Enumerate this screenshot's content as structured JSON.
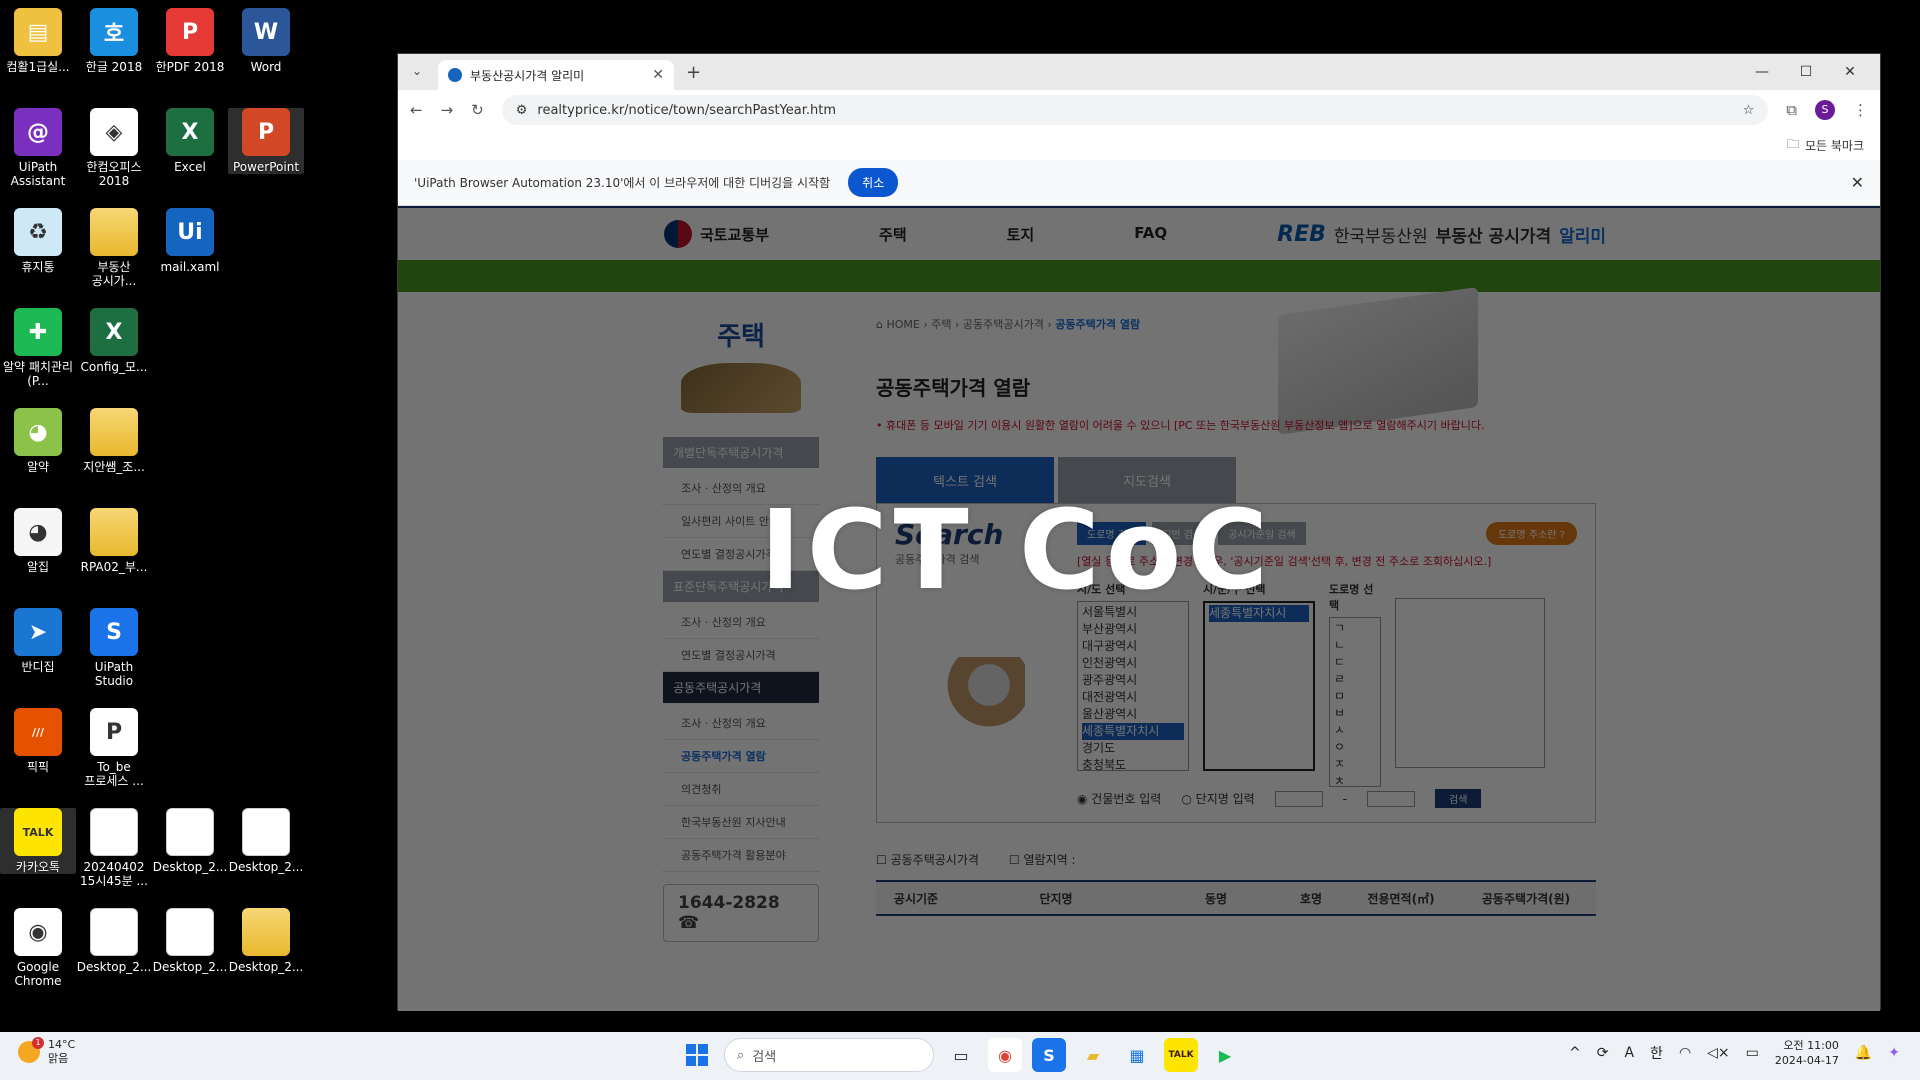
{
  "desktop": {
    "icons": [
      {
        "label": "컴활1급실...",
        "glyph": "▤",
        "color": "#f0c040"
      },
      {
        "label": "한글 2018",
        "glyph": "호",
        "color": "#1a8fe0"
      },
      {
        "label": "한PDF 2018",
        "glyph": "P",
        "color": "#e53935"
      },
      {
        "label": "Word",
        "glyph": "W",
        "color": "#2b579a"
      },
      {
        "label": "UiPath Assistant",
        "glyph": "@",
        "color": "#7b2fbe"
      },
      {
        "label": "한컴오피스 2018",
        "glyph": "◈",
        "color": "#ffffff"
      },
      {
        "label": "Excel",
        "glyph": "X",
        "color": "#1d6f42"
      },
      {
        "label": "PowerPoint",
        "glyph": "P",
        "color": "#d24726"
      },
      {
        "label": "휴지통",
        "glyph": "♻",
        "color": "#cfe8f5"
      },
      {
        "label": "부동산 공시가...",
        "glyph": "",
        "color": "#f0c040"
      },
      {
        "label": "mail.xaml",
        "glyph": "Ui",
        "color": "#1565c0"
      },
      {
        "label": "알약 패치관리(P...",
        "glyph": "✚",
        "color": "#1db954"
      },
      {
        "label": "Config_모...",
        "glyph": "X",
        "color": "#1d6f42"
      },
      {
        "label": "알약",
        "glyph": "◕",
        "color": "#8bc34a"
      },
      {
        "label": "지안쌤_조...",
        "glyph": "",
        "color": "#f0c040"
      },
      {
        "label": "알집",
        "glyph": "◕",
        "color": "#f5f5f5"
      },
      {
        "label": "RPA02_부...",
        "glyph": "",
        "color": "#f0c040"
      },
      {
        "label": "반디집",
        "glyph": "➤",
        "color": "#1976d2"
      },
      {
        "label": "UiPath Studio",
        "glyph": "S",
        "color": "#1a73e8"
      },
      {
        "label": "픽픽",
        "glyph": "///",
        "color": "#e65100"
      },
      {
        "label": "To_be 프로세스 ...",
        "glyph": "P",
        "color": "#ffffff"
      },
      {
        "label": "카카오톡",
        "glyph": "TALK",
        "color": "#fee500"
      },
      {
        "label": "20240402 15시45분 ...",
        "glyph": "",
        "color": "#ffffff"
      },
      {
        "label": "Desktop_2...",
        "glyph": "",
        "color": "#ffffff"
      },
      {
        "label": "Desktop_2...",
        "glyph": "",
        "color": "#ffffff"
      },
      {
        "label": "Google Chrome",
        "glyph": "◉",
        "color": "#ffffff"
      },
      {
        "label": "Desktop_2...",
        "glyph": "",
        "color": "#ffffff"
      },
      {
        "label": "Desktop_2...",
        "glyph": "",
        "color": "#ffffff"
      },
      {
        "label": "Desktop_2...",
        "glyph": "",
        "color": "#f0c040"
      }
    ]
  },
  "browser": {
    "tab_title": "부동산공시가격 알리미",
    "url": "realtyprice.kr/notice/town/searchPastYear.htm",
    "bookmarks_label": "모든 북마크",
    "profile_initial": "S",
    "infobar_text": "'UiPath Browser Automation 23.10'에서 이 브라우저에 대한 디버깅을 시작함",
    "infobar_cancel": "취소"
  },
  "site": {
    "molit": "국토교통부",
    "gnb": [
      "주택",
      "토지",
      "FAQ"
    ],
    "reb_mark": "REB",
    "reb_name": "한국부동산원",
    "reb_service": "부동산 공시가격",
    "reb_hl": "알리미",
    "lnb_title": "주택",
    "lnb": [
      {
        "type": "sec",
        "label": "개별단독주택공시가격"
      },
      {
        "type": "sub",
        "label": "조사 · 산정의 개요"
      },
      {
        "type": "sub",
        "label": "일사편리 사이트 안내"
      },
      {
        "type": "sub",
        "label": "연도별 결정공시가격"
      },
      {
        "type": "sec",
        "label": "표준단독주택공시가격"
      },
      {
        "type": "sub",
        "label": "조사 · 산정의 개요"
      },
      {
        "type": "sub",
        "label": "연도별 결정공시가격"
      },
      {
        "type": "sec-on",
        "label": "공동주택공시가격"
      },
      {
        "type": "sub",
        "label": "조사 · 산정의 개요"
      },
      {
        "type": "sub-on",
        "label": "공동주택가격 열람"
      },
      {
        "type": "sub",
        "label": "의견청취"
      },
      {
        "type": "sub",
        "label": "한국부동산원 지사안내"
      },
      {
        "type": "sub",
        "label": "공동주택가격 활용분야"
      }
    ],
    "phone": "1644-2828",
    "breadcrumb": [
      "HOME",
      "주택",
      "공동주택공시가격"
    ],
    "breadcrumb_current": "공동주택가격 열람",
    "page_title": "공동주택가격 열람",
    "notice": "• 휴대폰 등 모바일 기기 이용시 원활한 열람이 어려울 수 있으니 [PC 또는 한국부동산원 부동산정보 앱]으로 열람해주시기 바랍니다.",
    "search_tabs": [
      "텍스트 검색",
      "지도검색"
    ],
    "search_big": "Search",
    "search_small": "공동주택가격 검색",
    "mini_tabs": [
      "도로명 검색",
      "지번 검색",
      "공시가준일 검색"
    ],
    "road_btn": "도로명 주소란",
    "warn": "[열실 등으로 주소가 변경된경우, '공시기준일 검색'선택 후, 변경 전 주소로 조회하십시오.]",
    "sido_header": "시/도 선택",
    "sido": [
      "서울특별시",
      "부산광역시",
      "대구광역시",
      "인천광역시",
      "광주광역시",
      "대전광역시",
      "울산광역시",
      "세종특별자치시",
      "경기도",
      "충청북도"
    ],
    "sigungu_header": "시/군/구 선택",
    "sigungu": [
      "세종특별자치시"
    ],
    "road_header": "도로명 선택",
    "road": [
      "ㄱ",
      "ㄴ",
      "ㄷ",
      "ㄹ",
      "ㅁ",
      "ㅂ",
      "ㅅ",
      "ㅇ",
      "ㅈ",
      "ㅊ"
    ],
    "radio_building": "건물번호 입력",
    "radio_complex": "단지명 입력",
    "search_btn": "검색",
    "result_label": "공동주택공시가격",
    "result_area": "열람지역 :",
    "columns": [
      "공시기준",
      "단지명",
      "동명",
      "호명",
      "전용면적(㎡)",
      "공동주택가격(원)"
    ]
  },
  "watermark": "ICT CoC",
  "taskbar": {
    "weather_temp": "14°C",
    "weather_desc": "맑음",
    "weather_badge": "1",
    "search_placeholder": "검색",
    "ime": "한",
    "font_a": "A",
    "time": "오전 11:00",
    "date": "2024-04-17"
  }
}
